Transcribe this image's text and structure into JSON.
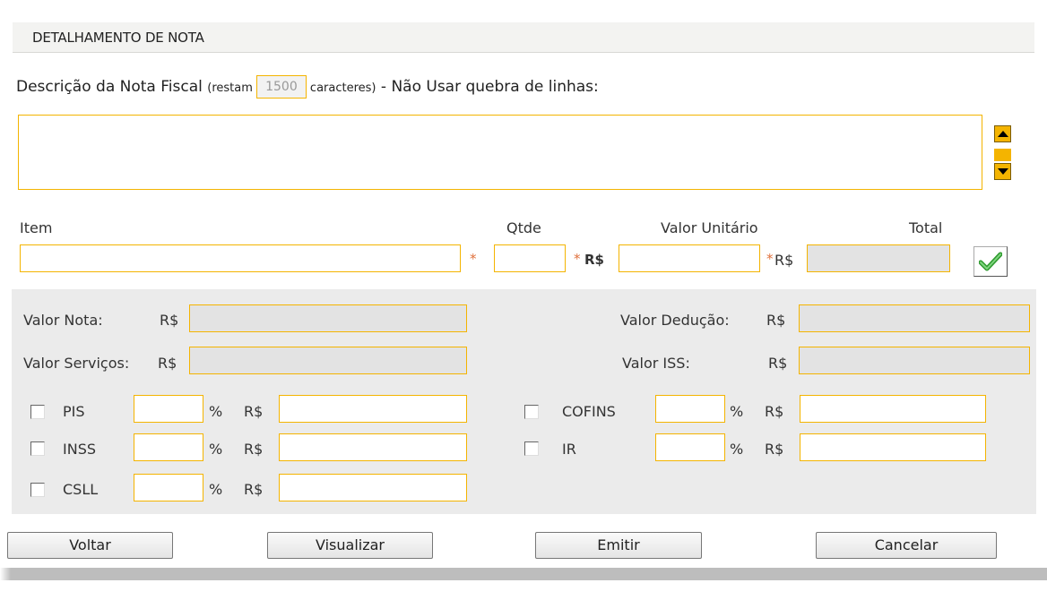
{
  "header": {
    "title": "DETALHAMENTO DE NOTA"
  },
  "description": {
    "label_prefix": "Descrição da Nota Fiscal",
    "label_restam": "(restam",
    "remaining": "1500",
    "label_caracteres": "caracteres)",
    "label_suffix": "- Não Usar quebra de linhas:",
    "value": ""
  },
  "item_row": {
    "item_label": "Item",
    "qtde_label": "Qtde",
    "valor_unitario_label": "Valor Unitário",
    "total_label": "Total",
    "asterisk": "*",
    "currency_bold": "R$",
    "currency": "R$",
    "item_value": "",
    "qtde_value": "",
    "valor_unitario_value": "",
    "total_value": ""
  },
  "totals": {
    "valor_nota_label": "Valor Nota:",
    "valor_servicos_label": "Valor Serviços:",
    "valor_deducao_label": "Valor Dedução:",
    "valor_iss_label": "Valor ISS:",
    "currency": "R$"
  },
  "taxes": {
    "percent": "%",
    "currency": "R$",
    "left": [
      {
        "label": "PIS",
        "checked": false,
        "rate": "",
        "amount": ""
      },
      {
        "label": "INSS",
        "checked": false,
        "rate": "",
        "amount": ""
      },
      {
        "label": "CSLL",
        "checked": false,
        "rate": "",
        "amount": ""
      }
    ],
    "right": [
      {
        "label": "COFINS",
        "checked": false,
        "rate": "",
        "amount": ""
      },
      {
        "label": "IR",
        "checked": false,
        "rate": "",
        "amount": ""
      }
    ]
  },
  "buttons": {
    "voltar": "Voltar",
    "visualizar": "Visualizar",
    "emitir": "Emitir",
    "cancelar": "Cancelar"
  },
  "colors": {
    "input_border": "#f4b400",
    "readonly_fill": "#e3e3e3",
    "panel_bg": "#ebebeb",
    "asterisk": "#e0703c",
    "check_green": "#3aa83a"
  },
  "icons": {
    "scroll_up": "triangle-up-icon",
    "scroll_down": "triangle-down-icon",
    "confirm": "checkmark-icon"
  }
}
